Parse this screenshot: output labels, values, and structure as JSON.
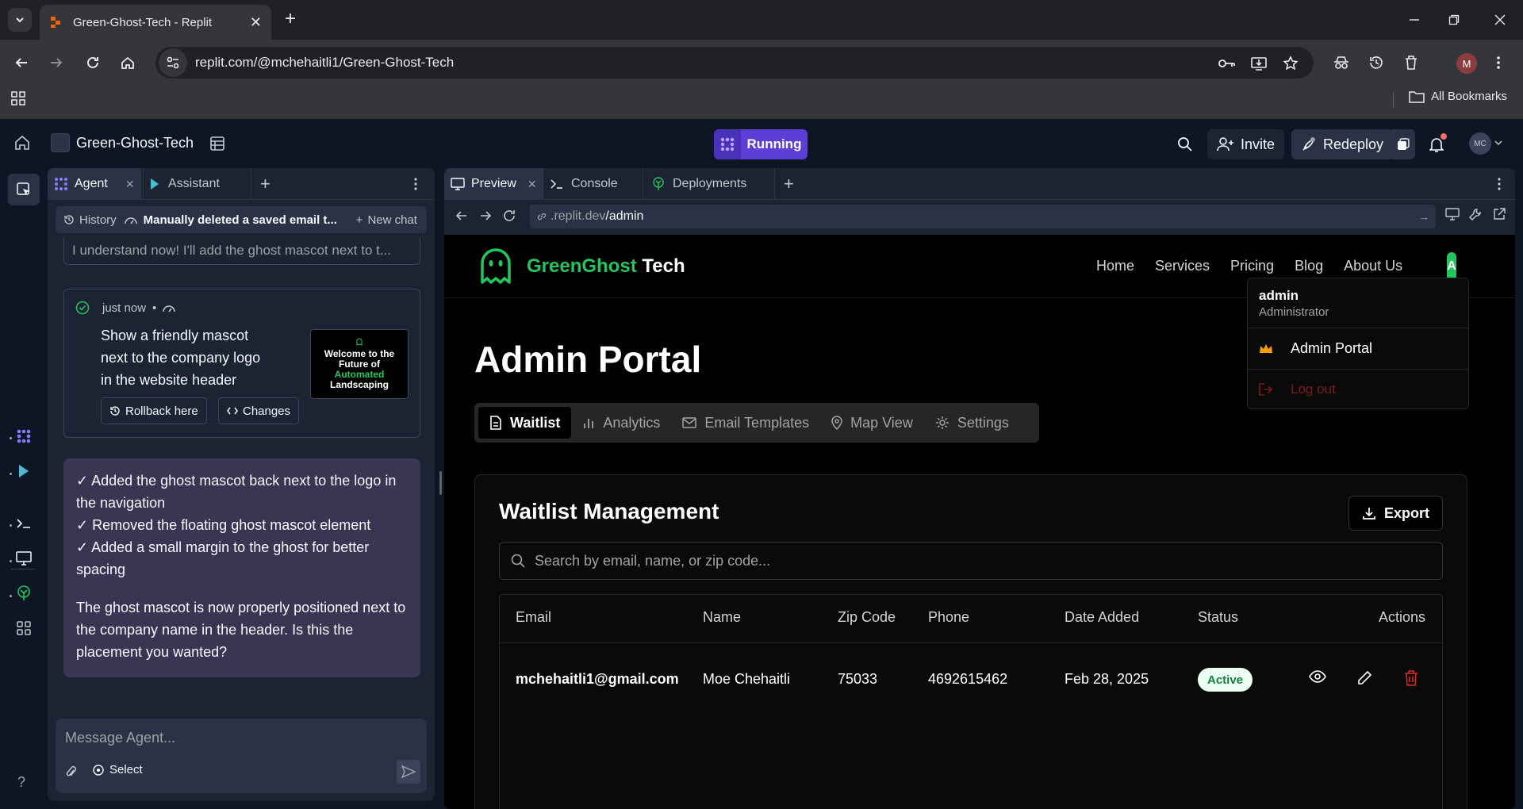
{
  "browser": {
    "tab_title": "Green-Ghost-Tech - Replit",
    "url": "replit.com/@mchehaitli1/Green-Ghost-Tech",
    "profile_initial": "M",
    "all_bookmarks": "All Bookmarks"
  },
  "topbar": {
    "repl_name": "Green-Ghost-Tech",
    "run_status": "Running",
    "invite_label": "Invite",
    "redeploy_label": "Redeploy",
    "user_initials": "MC"
  },
  "agent_panel": {
    "tabs": [
      "Agent",
      "Assistant"
    ],
    "history_label": "History",
    "chat_title": "Manually deleted a saved email t...",
    "new_chat_label": "New chat",
    "previous_message": "I understand now! I'll add the ghost mascot next to t...",
    "checkpoint": {
      "time": "just now",
      "separator": "•",
      "prompt": "Show a friendly mascot next to the company logo in the website header",
      "thumb_line1": "Welcome to the",
      "thumb_line2": "Future of",
      "thumb_line3": "Automated",
      "thumb_line4": "Landscaping",
      "rollback_label": "Rollback here",
      "changes_label": "Changes"
    },
    "reply": {
      "items": [
        "✓ Added the ghost mascot back next to the logo in the navigation",
        "✓ Removed the floating ghost mascot element",
        "✓ Added a small margin to the ghost for better spacing"
      ],
      "summary": "The ghost mascot is now properly positioned next to the company name in the header. Is this the placement you wanted?"
    },
    "composer_placeholder": "Message Agent...",
    "select_label": "Select"
  },
  "preview_panel": {
    "tabs": [
      "Preview",
      "Console",
      "Deployments"
    ],
    "url_domain": ".replit.dev",
    "url_path": "/admin"
  },
  "site": {
    "brand_green": "GreenGhost",
    "brand_white": "Tech",
    "nav": [
      "Home",
      "Services",
      "Pricing",
      "Blog",
      "About Us"
    ],
    "avatar_initial": "A",
    "page_title": "Admin Portal",
    "admin_tabs": [
      "Waitlist",
      "Analytics",
      "Email Templates",
      "Map View",
      "Settings"
    ],
    "waitlist": {
      "title": "Waitlist Management",
      "export_label": "Export",
      "search_placeholder": "Search by email, name, or zip code...",
      "columns": [
        "Email",
        "Name",
        "Zip Code",
        "Phone",
        "Date Added",
        "Status",
        "Actions"
      ],
      "rows": [
        {
          "email": "mchehaitli1@gmail.com",
          "name": "Moe Chehaitli",
          "zip": "75033",
          "phone": "4692615462",
          "date": "Feb 28, 2025",
          "status": "Active"
        }
      ]
    },
    "user_menu": {
      "name": "admin",
      "role": "Administrator",
      "admin_portal": "Admin Portal",
      "logout": "Log out"
    }
  },
  "colors": {
    "brand_green": "#22c55e",
    "run_purple": "#5b3fd6",
    "agent_bubble": "#3a3553",
    "danger": "#dc2626"
  }
}
